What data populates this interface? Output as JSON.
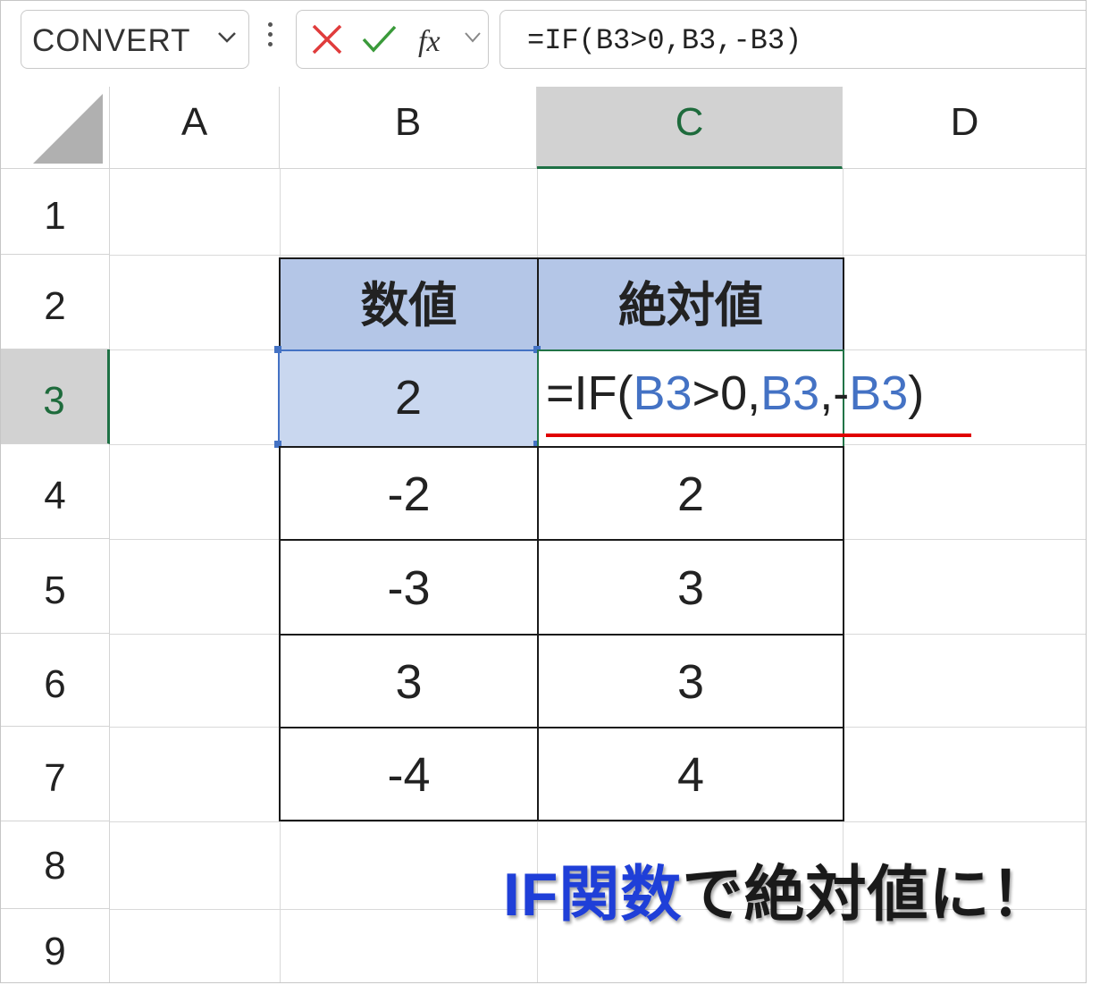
{
  "formula_bar": {
    "name_box": "CONVERT",
    "cancel_icon": "x-icon",
    "enter_icon": "check-icon",
    "fx_label": "fx",
    "formula_text": "=IF(B3>0,B3,-B3)"
  },
  "columns": [
    "A",
    "B",
    "C",
    "D"
  ],
  "rows": [
    "1",
    "2",
    "3",
    "4",
    "5",
    "6",
    "7",
    "8",
    "9"
  ],
  "table": {
    "headers": [
      "数値",
      "絶対値"
    ],
    "rows": [
      {
        "value": "2",
        "abs": ""
      },
      {
        "value": "-2",
        "abs": "2"
      },
      {
        "value": "-3",
        "abs": "3"
      },
      {
        "value": "3",
        "abs": "3"
      },
      {
        "value": "-4",
        "abs": "4"
      }
    ]
  },
  "edit_cell": {
    "prefix": "=IF(",
    "ref1": "B3",
    "mid1": ">0,",
    "ref2": "B3",
    "mid2": ",-",
    "ref3": "B3",
    "suffix": ")"
  },
  "caption": {
    "highlight": "IF関数",
    "rest": "で絶対値に！"
  },
  "colors": {
    "header_fill": "#b4c6e7",
    "selection": "#4472c4",
    "active_green": "#1e7145",
    "underline": "#e00000",
    "caption_blue": "#1f3fd8"
  }
}
